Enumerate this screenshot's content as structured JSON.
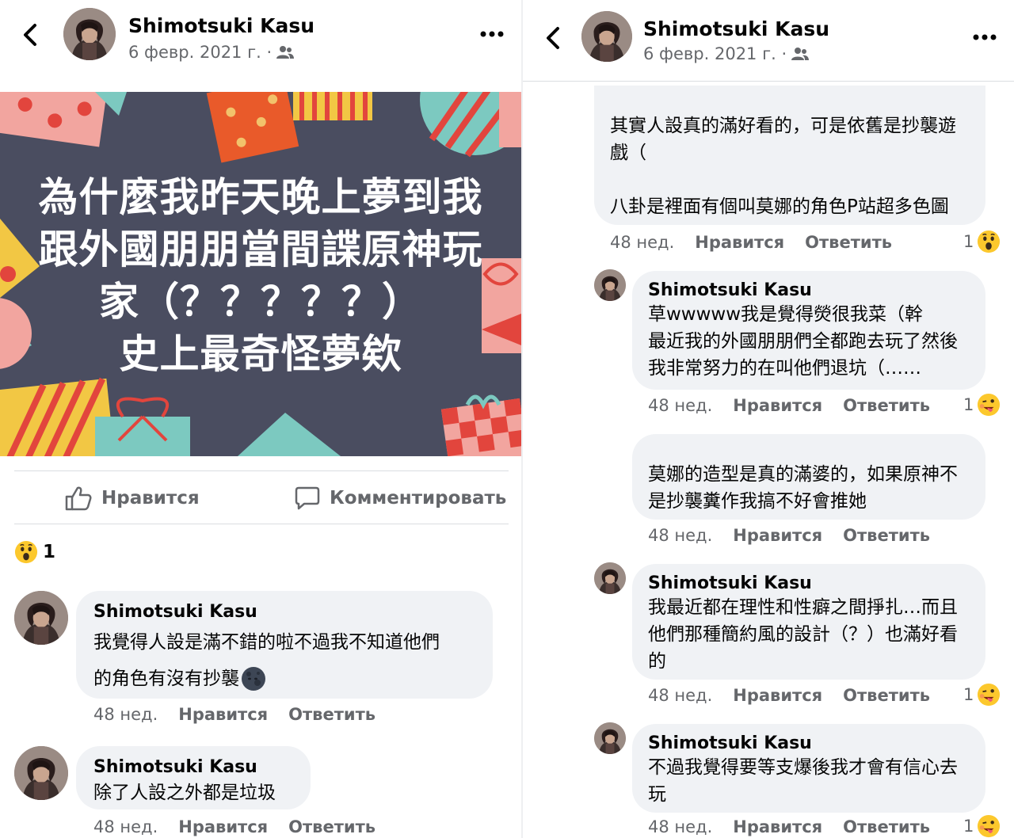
{
  "post": {
    "author": "Shimotsuki Kasu",
    "date": "6 февр. 2021 г. ·",
    "image_text": [
      "為什麼我昨天晚上夢到我",
      "跟外國朋朋當間諜原神玩",
      "家（？？？？？）",
      "史上最奇怪夢欸"
    ],
    "like_label": "Нравится",
    "comment_label": "Комментировать",
    "reaction_count": "1"
  },
  "left_comments": [
    {
      "name": "Shimotsuki Kasu",
      "lines": [
        "我覺得人設是滿不錯的啦不過我不知道他們",
        "的角色有沒有抄襲"
      ],
      "time": "48 нед.",
      "like": "Нравится",
      "reply": "Ответить"
    },
    {
      "name": "Shimotsuki Kasu",
      "lines": [
        "除了人設之外都是垃圾"
      ],
      "time": "48 нед.",
      "like": "Нравится",
      "reply": "Ответить"
    }
  ],
  "right_header": {
    "author": "Shimotsuki Kasu",
    "date": "6 февр. 2021 г. ·"
  },
  "right_comments": [
    {
      "name": "",
      "lines": [
        "其實人設真的滿好看的，可是依舊是抄襲遊",
        "戲（",
        "",
        "八卦是裡面有個叫莫娜的角色P站超多色圖"
      ],
      "time": "48 нед.",
      "like": "Нравится",
      "reply": "Ответить",
      "reactions": "1"
    },
    {
      "name": "Shimotsuki Kasu",
      "lines": [
        "草wwwww我是覺得熒很我菜（幹",
        "最近我的外國朋朋們全都跑去玩了然後",
        "我非常努力的在叫他們退坑（……"
      ],
      "time": "48 нед.",
      "like": "Нравится",
      "reply": "Ответить",
      "reactions": "1"
    },
    {
      "name": "",
      "lines": [
        "莫娜的造型是真的滿婆的，如果原神不",
        "是抄襲糞作我搞不好會推她"
      ],
      "time": "48 нед.",
      "like": "Нравится",
      "reply": "Ответить",
      "reactions": ""
    },
    {
      "name": "Shimotsuki Kasu",
      "lines": [
        "我最近都在理性和性癖之間掙扎…而且",
        "他們那種簡約風的設計（？）也滿好看",
        "的"
      ],
      "time": "48 нед.",
      "like": "Нравится",
      "reply": "Ответить",
      "reactions": "1"
    },
    {
      "name": "Shimotsuki Kasu",
      "lines": [
        "不過我覺得要等支爆後我才會有信心去",
        "玩"
      ],
      "time": "48 нед.",
      "like": "Нравится",
      "reply": "Ответить",
      "reactions": "1"
    }
  ],
  "colors": {
    "accent_text": "#050505",
    "muted": "#65676b",
    "bubble": "#f0f2f5",
    "image_bg": "#4a4d60"
  },
  "icons": [
    "back-arrow-icon",
    "more-icon",
    "friends-icon",
    "like-thumb-icon",
    "comment-icon",
    "wow-emoji-icon",
    "drool-emoji-icon",
    "moon-emoji-icon"
  ]
}
